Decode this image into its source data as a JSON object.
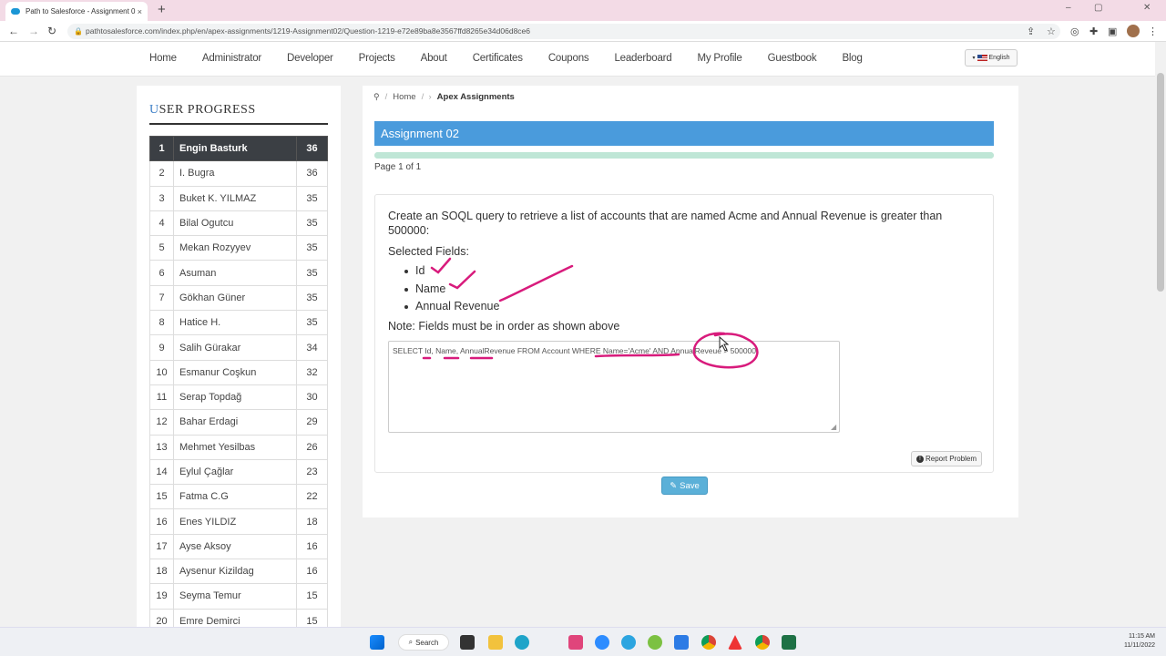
{
  "browser": {
    "tab_title": "Path to Salesforce - Assignment 0",
    "tab_close": "×",
    "new_tab": "+",
    "url": "pathtosalesforce.com/index.php/en/apex-assignments/1219-Assignment02/Question-1219-e72e89ba8e3567ffd8265e34d06d8ce6",
    "window_controls": [
      "–",
      "▢",
      "✕"
    ]
  },
  "site_nav": {
    "items": [
      "Home",
      "Administrator",
      "Developer",
      "Projects",
      "About",
      "Certificates",
      "Coupons",
      "Leaderboard",
      "My Profile",
      "Guestbook",
      "Blog"
    ],
    "language": "English"
  },
  "user_progress": {
    "title_first": "U",
    "title_rest": "SER PROGRESS",
    "rows": [
      {
        "rank": "1",
        "name": "Engin Basturk",
        "score": "36"
      },
      {
        "rank": "2",
        "name": "I. Bugra",
        "score": "36"
      },
      {
        "rank": "3",
        "name": "Buket K. YILMAZ",
        "score": "35"
      },
      {
        "rank": "4",
        "name": "Bilal Ogutcu",
        "score": "35"
      },
      {
        "rank": "5",
        "name": "Mekan Rozyyev",
        "score": "35"
      },
      {
        "rank": "6",
        "name": "Asuman",
        "score": "35"
      },
      {
        "rank": "7",
        "name": "Gökhan Güner",
        "score": "35"
      },
      {
        "rank": "8",
        "name": "Hatice H.",
        "score": "35"
      },
      {
        "rank": "9",
        "name": "Salih Gürakar",
        "score": "34"
      },
      {
        "rank": "10",
        "name": "Esmanur Coşkun",
        "score": "32"
      },
      {
        "rank": "11",
        "name": "Serap Topdağ",
        "score": "30"
      },
      {
        "rank": "12",
        "name": "Bahar Erdagi",
        "score": "29"
      },
      {
        "rank": "13",
        "name": "Mehmet Yesilbas",
        "score": "26"
      },
      {
        "rank": "14",
        "name": "Eylul Çağlar",
        "score": "23"
      },
      {
        "rank": "15",
        "name": "Fatma C.G",
        "score": "22"
      },
      {
        "rank": "16",
        "name": "Enes YILDIZ",
        "score": "18"
      },
      {
        "rank": "17",
        "name": "Ayse Aksoy",
        "score": "16"
      },
      {
        "rank": "18",
        "name": "Aysenur Kizildag",
        "score": "16"
      },
      {
        "rank": "19",
        "name": "Seyma Temur",
        "score": "15"
      },
      {
        "rank": "20",
        "name": "Emre Demirci",
        "score": "15"
      }
    ]
  },
  "breadcrumb": {
    "home": "Home",
    "current": "Apex Assignments"
  },
  "assignment": {
    "title": "Assignment 02",
    "progress_fraction": 1.0,
    "page_info": "Page 1 of 1",
    "question": "Create an SOQL query to retrieve a list of accounts that are named Acme and Annual Revenue is greater than 500000:",
    "selected_label": "Selected Fields:",
    "fields": [
      "Id",
      "Name",
      "Annual Revenue"
    ],
    "note": "Note: Fields must be in order as shown above",
    "answer": "SELECT Id, Name, AnnualRevenue FROM Account WHERE Name='Acme' AND AnnualReveue > 500000",
    "report_label": "Report Problem",
    "save_label": "Save"
  },
  "taskbar": {
    "search_label": "Search",
    "time": "11:15 AM",
    "date": "11/11/2022"
  },
  "colors": {
    "header_blue": "#4a9bdc",
    "ink_pink": "#d81b7c",
    "save_blue": "#5bb0d8"
  }
}
